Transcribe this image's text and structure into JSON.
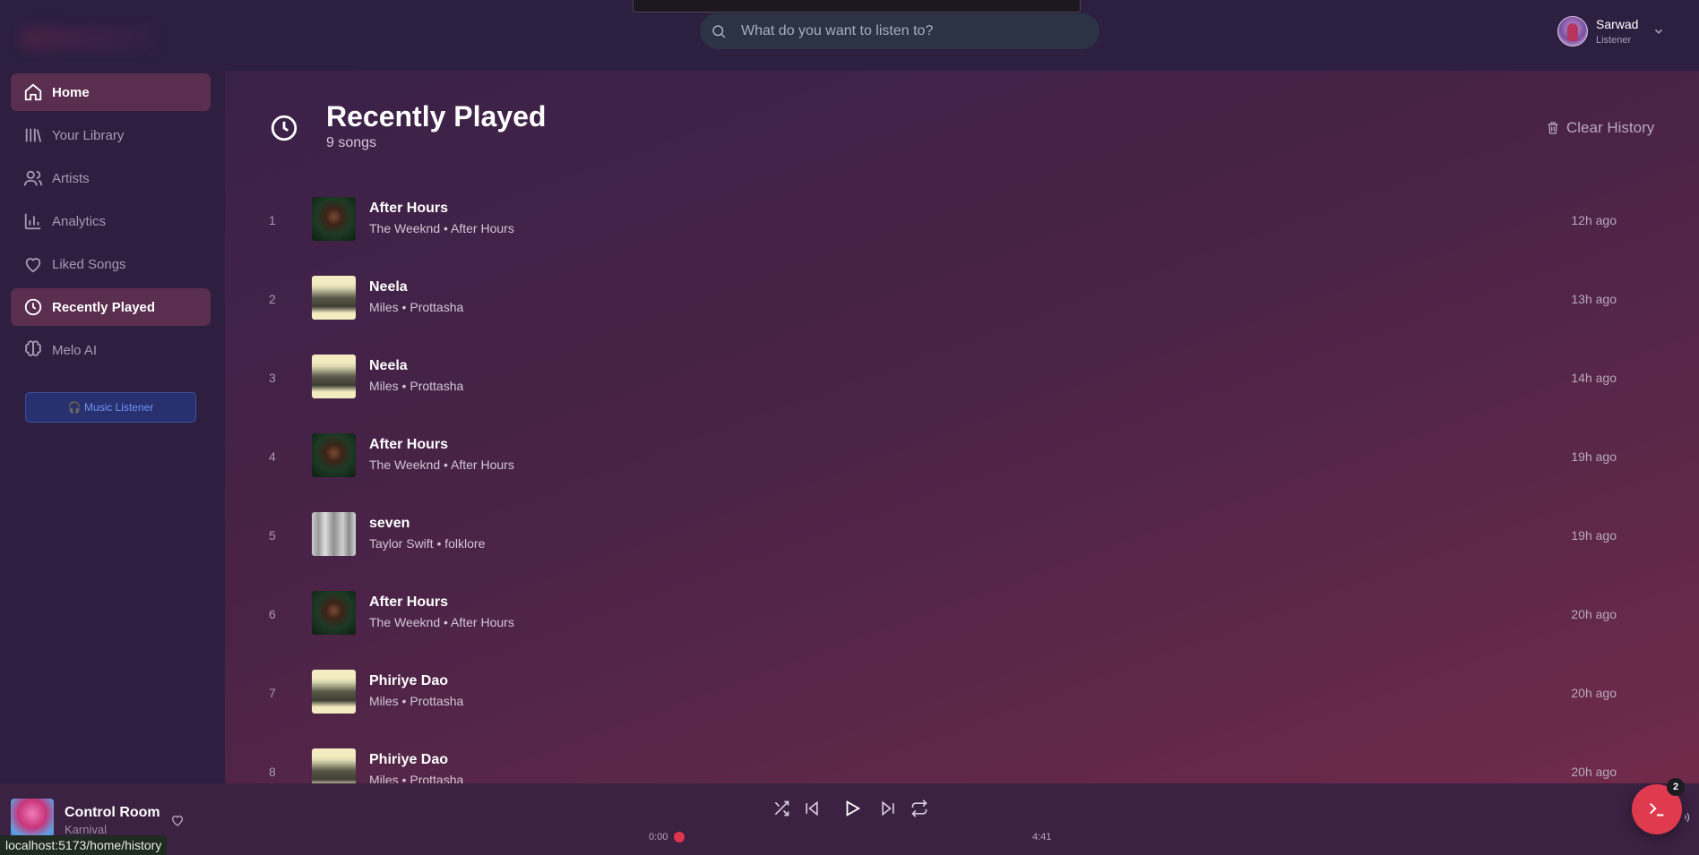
{
  "header": {
    "search_placeholder": "What do you want to listen to?",
    "user": {
      "name": "Sarwad",
      "role": "Listener"
    }
  },
  "sidebar": {
    "items": [
      {
        "label": "Home",
        "icon": "home-icon",
        "active": true
      },
      {
        "label": "Your Library",
        "icon": "library-icon",
        "active": false
      },
      {
        "label": "Artists",
        "icon": "users-icon",
        "active": false
      },
      {
        "label": "Analytics",
        "icon": "bar-chart-icon",
        "active": false
      },
      {
        "label": "Liked Songs",
        "icon": "heart-icon",
        "active": false
      },
      {
        "label": "Recently Played",
        "icon": "clock-icon",
        "active": true
      },
      {
        "label": "Melo AI",
        "icon": "brain-icon",
        "active": false
      }
    ],
    "role_badge": "🎧 Music Listener"
  },
  "main": {
    "title": "Recently Played",
    "subtitle": "9 songs",
    "clear_label": "Clear History",
    "tracks": [
      {
        "num": "1",
        "title": "After Hours",
        "meta": "The Weeknd • After Hours",
        "time": "12h ago",
        "art": "weeknd"
      },
      {
        "num": "2",
        "title": "Neela",
        "meta": "Miles • Prottasha",
        "time": "13h ago",
        "art": "miles"
      },
      {
        "num": "3",
        "title": "Neela",
        "meta": "Miles • Prottasha",
        "time": "14h ago",
        "art": "miles"
      },
      {
        "num": "4",
        "title": "After Hours",
        "meta": "The Weeknd • After Hours",
        "time": "19h ago",
        "art": "weeknd"
      },
      {
        "num": "5",
        "title": "seven",
        "meta": "Taylor Swift • folklore",
        "time": "19h ago",
        "art": "folklore"
      },
      {
        "num": "6",
        "title": "After Hours",
        "meta": "The Weeknd • After Hours",
        "time": "20h ago",
        "art": "weeknd"
      },
      {
        "num": "7",
        "title": "Phiriye Dao",
        "meta": "Miles • Prottasha",
        "time": "20h ago",
        "art": "miles"
      },
      {
        "num": "8",
        "title": "Phiriye Dao",
        "meta": "Miles • Prottasha",
        "time": "20h ago",
        "art": "miles"
      }
    ]
  },
  "player": {
    "title": "Control Room",
    "artist": "Karnival",
    "time_current": "0:00",
    "time_total": "4:41",
    "progress": 0
  },
  "fab": {
    "badge": "2"
  },
  "status_url": "localhost:5173/home/history",
  "colors": {
    "accent": "#e0344f",
    "active_nav": "#5a2e4e",
    "badge_blue": "#6f95f0"
  }
}
